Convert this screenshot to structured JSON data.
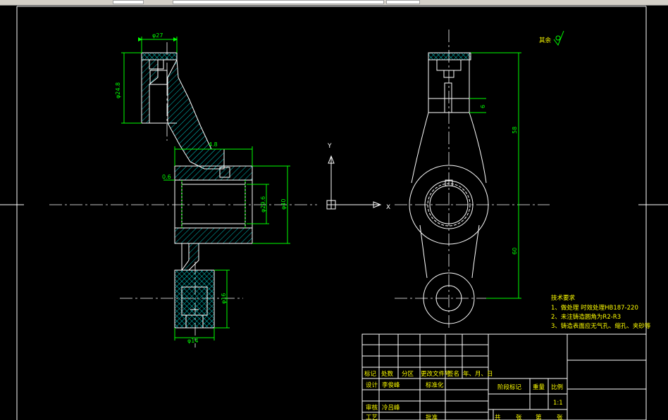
{
  "drawing": {
    "roughness_note": "其余",
    "dimensions": {
      "side_top_width": "φ27",
      "side_top_height": "φ24.8",
      "side_mid_width": "4.8",
      "side_left_small": "0.6",
      "side_bore_dia": "φ29.6",
      "side_outer_dia": "φ40",
      "side_bottom_width": "φ14",
      "side_bottom_height": "φ16",
      "front_upper": "58",
      "front_lower": "60",
      "front_small": "6"
    },
    "axes": {
      "y": "Y",
      "x": "X"
    },
    "tech_requirements": {
      "title": "技术要求",
      "items": [
        "1、做处理 时效处理HB187-220",
        "2、未注铸造圆角为R2-R3",
        "3、铸造表面应无气孔、缩孔、夹砂等"
      ]
    },
    "title_block": {
      "header_row": [
        "标记",
        "处数",
        "分区",
        "更改文件号",
        "签名",
        "年、月、日"
      ],
      "design_label": "设计",
      "designer": "李俊峰",
      "standard_label": "标准化",
      "review_label": "审核",
      "reviewer": "冷吕峰",
      "process_label": "工艺",
      "approve_label": "批准",
      "stage_label": "阶段标记",
      "weight_label": "重量",
      "scale_label": "比例",
      "scale_value": "1:1",
      "sheet_total": "共",
      "sheet_unit1": "张",
      "sheet_index": "第",
      "sheet_unit2": "张"
    }
  }
}
